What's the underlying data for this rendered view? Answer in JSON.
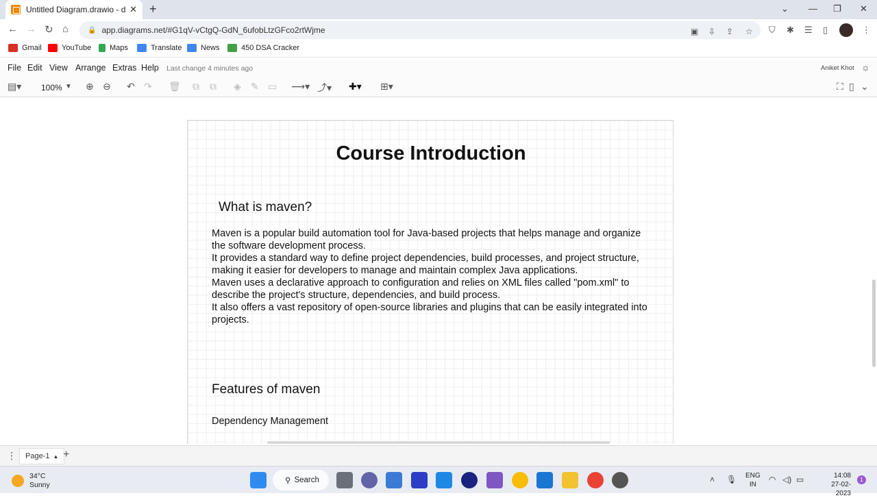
{
  "browser": {
    "tab_title": "Untitled Diagram.drawio - diagra",
    "url": "app.diagrams.net/#G1qV-vCtgQ-GdN_6ufobLtzGFco2rtWjme"
  },
  "bookmarks": [
    {
      "label": "Gmail",
      "color": "#d93025"
    },
    {
      "label": "YouTube",
      "color": "#ff0000"
    },
    {
      "label": "Maps",
      "color": "#34a853"
    },
    {
      "label": "Translate",
      "color": "#4285f4"
    },
    {
      "label": "News",
      "color": "#4285f4"
    },
    {
      "label": "450 DSA Cracker",
      "color": "#43a047"
    }
  ],
  "menubar": {
    "items": [
      "File",
      "Edit",
      "View",
      "Arrange",
      "Extras",
      "Help"
    ],
    "last_change": "Last change 4 minutes ago",
    "user": "Aniket Khot"
  },
  "toolbar": {
    "zoom": "100%"
  },
  "diagram": {
    "title": "Course Introduction",
    "heading1": "What is maven?",
    "paragraph_lines": [
      "Maven is a popular build automation tool for Java-based projects that helps manage and organize",
      "the software development process.",
      "It provides a standard way to define project dependencies, build processes, and project structure,",
      "making it easier for developers to manage and maintain complex Java applications.",
      "Maven uses a declarative approach to configuration and relies on XML files called \"pom.xml\" to",
      "describe the project's structure, dependencies, and build process.",
      "It also offers a vast repository of open-source libraries and plugins that can be easily integrated into",
      "projects."
    ],
    "heading2": "Features of maven",
    "feature1": "Dependency Management"
  },
  "pages": {
    "current": "Page-1"
  },
  "taskbar": {
    "temperature": "34°C",
    "weather": "Sunny",
    "search_label": "Search",
    "lang_line1": "ENG",
    "lang_line2": "IN",
    "time": "14:08",
    "date": "27-02-2023",
    "notification_count": "1"
  }
}
